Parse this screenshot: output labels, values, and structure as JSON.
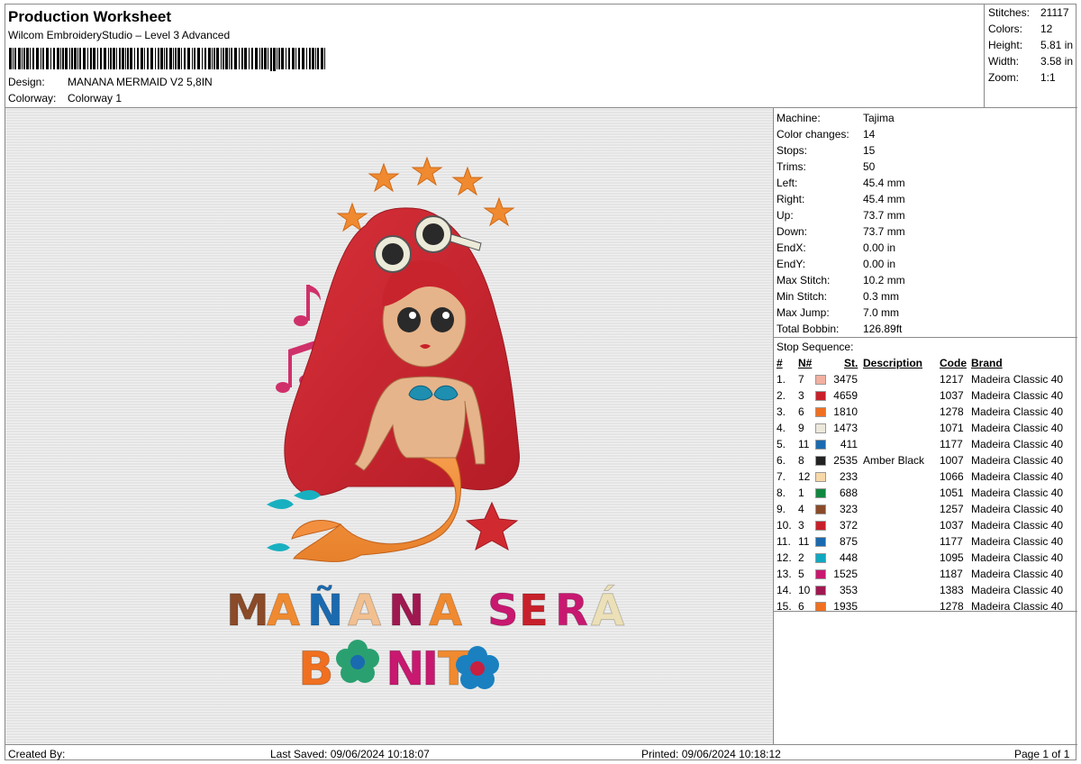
{
  "header": {
    "title": "Production Worksheet",
    "software": "Wilcom EmbroideryStudio – Level 3 Advanced",
    "design_label": "Design:",
    "design_value": "MANANA MERMAID V2 5,8IN",
    "colorway_label": "Colorway:",
    "colorway_value": "Colorway 1"
  },
  "summary": {
    "stitches_label": "Stitches:",
    "stitches_value": "21117",
    "colors_label": "Colors:",
    "colors_value": "12",
    "height_label": "Height:",
    "height_value": "5.81 in",
    "width_label": "Width:",
    "width_value": "3.58 in",
    "zoom_label": "Zoom:",
    "zoom_value": "1:1"
  },
  "machine": {
    "rows": [
      {
        "label": "Machine:",
        "value": "Tajima"
      },
      {
        "label": "Color changes:",
        "value": "14"
      },
      {
        "label": "Stops:",
        "value": "15"
      },
      {
        "label": "Trims:",
        "value": "50"
      },
      {
        "label": "Left:",
        "value": "45.4 mm"
      },
      {
        "label": "Right:",
        "value": "45.4 mm"
      },
      {
        "label": "Up:",
        "value": "73.7 mm"
      },
      {
        "label": "Down:",
        "value": "73.7 mm"
      },
      {
        "label": "EndX:",
        "value": "0.00 in"
      },
      {
        "label": "EndY:",
        "value": "0.00 in"
      },
      {
        "label": "Max Stitch:",
        "value": "10.2 mm"
      },
      {
        "label": "Min Stitch:",
        "value": "0.3 mm"
      },
      {
        "label": "Max Jump:",
        "value": "7.0 mm"
      },
      {
        "label": "Total Bobbin:",
        "value": "126.89ft"
      }
    ]
  },
  "stop_sequence": {
    "title": "Stop Sequence:",
    "headers": {
      "hash": "#",
      "n": "N#",
      "st": "St.",
      "desc": "Description",
      "code": "Code",
      "brand": "Brand"
    },
    "rows": [
      {
        "idx": "1.",
        "n": "7",
        "color": "#f2b0a0",
        "st": "3475",
        "desc": "",
        "code": "1217",
        "brand": "Madeira Classic 40"
      },
      {
        "idx": "2.",
        "n": "3",
        "color": "#c8202a",
        "st": "4659",
        "desc": "",
        "code": "1037",
        "brand": "Madeira Classic 40"
      },
      {
        "idx": "3.",
        "n": "6",
        "color": "#f07020",
        "st": "1810",
        "desc": "",
        "code": "1278",
        "brand": "Madeira Classic 40"
      },
      {
        "idx": "4.",
        "n": "9",
        "color": "#ece8dc",
        "st": "1473",
        "desc": "",
        "code": "1071",
        "brand": "Madeira Classic 40"
      },
      {
        "idx": "5.",
        "n": "11",
        "color": "#1a6ab0",
        "st": "411",
        "desc": "",
        "code": "1177",
        "brand": "Madeira Classic 40"
      },
      {
        "idx": "6.",
        "n": "8",
        "color": "#222222",
        "st": "2535",
        "desc": "Amber Black",
        "code": "1007",
        "brand": "Madeira Classic 40"
      },
      {
        "idx": "7.",
        "n": "12",
        "color": "#f8d8a8",
        "st": "233",
        "desc": "",
        "code": "1066",
        "brand": "Madeira Classic 40"
      },
      {
        "idx": "8.",
        "n": "1",
        "color": "#108840",
        "st": "688",
        "desc": "",
        "code": "1051",
        "brand": "Madeira Classic 40"
      },
      {
        "idx": "9.",
        "n": "4",
        "color": "#8b4a28",
        "st": "323",
        "desc": "",
        "code": "1257",
        "brand": "Madeira Classic 40"
      },
      {
        "idx": "10.",
        "n": "3",
        "color": "#c8202a",
        "st": "372",
        "desc": "",
        "code": "1037",
        "brand": "Madeira Classic 40"
      },
      {
        "idx": "11.",
        "n": "11",
        "color": "#1a6ab0",
        "st": "875",
        "desc": "",
        "code": "1177",
        "brand": "Madeira Classic 40"
      },
      {
        "idx": "12.",
        "n": "2",
        "color": "#10a8c0",
        "st": "448",
        "desc": "",
        "code": "1095",
        "brand": "Madeira Classic 40"
      },
      {
        "idx": "13.",
        "n": "5",
        "color": "#c81870",
        "st": "1525",
        "desc": "",
        "code": "1187",
        "brand": "Madeira Classic 40"
      },
      {
        "idx": "14.",
        "n": "10",
        "color": "#a01850",
        "st": "353",
        "desc": "",
        "code": "1383",
        "brand": "Madeira Classic 40"
      },
      {
        "idx": "15.",
        "n": "6",
        "color": "#f07020",
        "st": "1935",
        "desc": "",
        "code": "1278",
        "brand": "Madeira Classic 40"
      }
    ]
  },
  "design_text": {
    "line1": [
      "M",
      "A",
      "Ñ",
      "A",
      "N",
      "A",
      "S",
      "E",
      "R",
      "Á"
    ],
    "line2": [
      "B",
      "N",
      "I",
      "T"
    ]
  },
  "footer": {
    "created_by": "Created By:",
    "last_saved": "Last Saved: 09/06/2024 10:18:07",
    "printed": "Printed: 09/06/2024 10:18:12",
    "page": "Page 1 of 1"
  }
}
